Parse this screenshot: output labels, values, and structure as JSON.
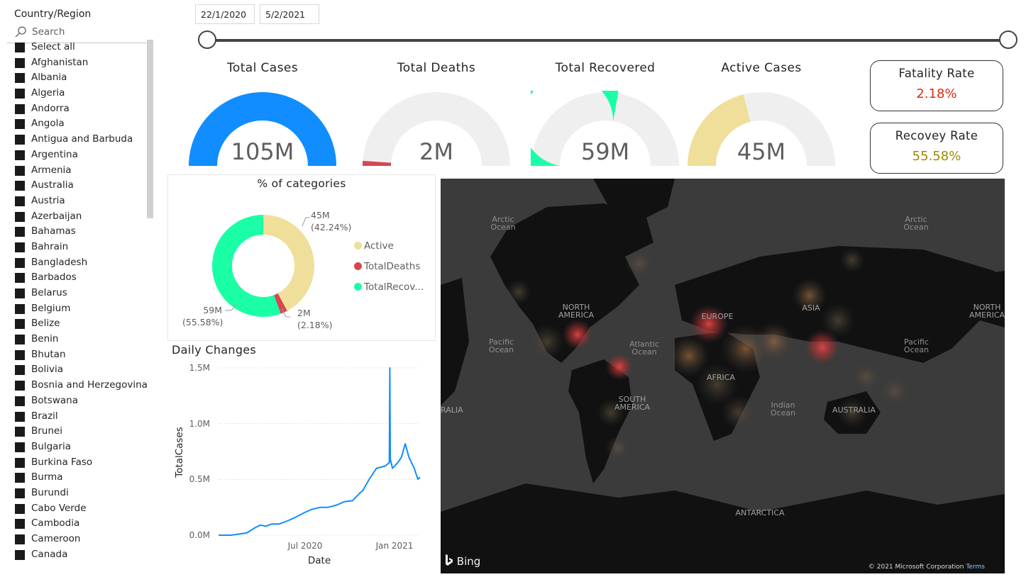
{
  "slicer": {
    "title": "Country/Region",
    "search_placeholder": "Search",
    "items": [
      "Select all",
      "Afghanistan",
      "Albania",
      "Algeria",
      "Andorra",
      "Angola",
      "Antigua and Barbuda",
      "Argentina",
      "Armenia",
      "Australia",
      "Austria",
      "Azerbaijan",
      "Bahamas",
      "Bahrain",
      "Bangladesh",
      "Barbados",
      "Belarus",
      "Belgium",
      "Belize",
      "Benin",
      "Bhutan",
      "Bolivia",
      "Bosnia and Herzegovina",
      "Botswana",
      "Brazil",
      "Brunei",
      "Bulgaria",
      "Burkina Faso",
      "Burma",
      "Burundi",
      "Cabo Verde",
      "Cambodia",
      "Cameroon",
      "Canada"
    ]
  },
  "date_range": {
    "start": "22/1/2020",
    "end": "5/2/2021"
  },
  "gauges": [
    {
      "title": "Total Cases",
      "value": "105M",
      "fraction": 1.0,
      "color": "#118DFF"
    },
    {
      "title": "Total Deaths",
      "value": "2M",
      "fraction": 0.0218,
      "color": "#D64550"
    },
    {
      "title": "Total Recovered",
      "value": "59M",
      "fraction": 0.5558,
      "color": "#1AFFA6"
    },
    {
      "title": "Active Cases",
      "value": "45M",
      "fraction": 0.4224,
      "color": "#F0DF9A"
    }
  ],
  "rates": {
    "fatality": {
      "title": "Fatality Rate",
      "value": "2.18%",
      "color": "#E02B10"
    },
    "recovery": {
      "title": "Recovey Rate",
      "value": "55.58%",
      "color": "#A08A00"
    }
  },
  "donut": {
    "title": "% of categories",
    "legend": [
      {
        "label": "Active",
        "color": "#F0DF9A"
      },
      {
        "label": "TotalDeaths",
        "color": "#D64550"
      },
      {
        "label": "TotalRecov...",
        "color": "#1AFFA6"
      }
    ],
    "labels": {
      "active": {
        "value": "45M",
        "pct": "(42.24%)"
      },
      "deaths": {
        "value": "2M",
        "pct": "(2.18%)"
      },
      "recovered": {
        "value": "59M",
        "pct": "(55.58%)"
      }
    }
  },
  "chart_data": [
    {
      "type": "pie",
      "title": "% of categories",
      "categories": [
        "Active",
        "TotalDeaths",
        "TotalRecovered"
      ],
      "values": [
        45,
        2,
        59
      ],
      "percent": [
        42.24,
        2.18,
        55.58
      ],
      "unit": "M",
      "legend": "right"
    },
    {
      "type": "line",
      "title": "Daily Changes",
      "xlabel": "Date",
      "ylabel": "TotalCases",
      "x_ticks": [
        "Jul 2020",
        "Jan 2021"
      ],
      "y_ticks": [
        "0.0M",
        "0.5M",
        "1.0M",
        "1.5M"
      ],
      "ylim": [
        0,
        1.5
      ],
      "x_range": [
        "2020-01-22",
        "2021-02-05"
      ],
      "series": [
        {
          "color": "#118DFF",
          "x": [
            "2020-01-22",
            "2020-02-15",
            "2020-03-15",
            "2020-04-01",
            "2020-04-10",
            "2020-04-20",
            "2020-05-01",
            "2020-05-15",
            "2020-06-01",
            "2020-06-15",
            "2020-07-01",
            "2020-07-15",
            "2020-08-01",
            "2020-08-15",
            "2020-09-01",
            "2020-09-15",
            "2020-10-01",
            "2020-10-15",
            "2020-10-20",
            "2020-11-01",
            "2020-11-15",
            "2020-12-01",
            "2020-12-09",
            "2020-12-10",
            "2020-12-11",
            "2020-12-15",
            "2020-12-25",
            "2021-01-01",
            "2021-01-08",
            "2021-01-15",
            "2021-01-25",
            "2021-02-01",
            "2021-02-05"
          ],
          "y": [
            0.0,
            0.0,
            0.02,
            0.07,
            0.09,
            0.08,
            0.1,
            0.1,
            0.13,
            0.16,
            0.2,
            0.23,
            0.25,
            0.25,
            0.27,
            0.3,
            0.31,
            0.38,
            0.4,
            0.5,
            0.6,
            0.62,
            0.65,
            1.5,
            0.68,
            0.6,
            0.65,
            0.7,
            0.82,
            0.7,
            0.6,
            0.5,
            0.52
          ]
        }
      ]
    }
  ],
  "line": {
    "title": "Daily Changes",
    "xlabel": "Date",
    "ylabel": "TotalCases",
    "x_tick_1": "Jul 2020",
    "x_tick_2": "Jan 2021",
    "y0": "0.0M",
    "y1": "0.5M",
    "y2": "1.0M",
    "y3": "1.5M"
  },
  "map": {
    "labels": {
      "north_america": "NORTH AMERICA",
      "north_america_2": "NORTH AMERICA",
      "europe": "EUROPE",
      "asia": "ASIA",
      "africa": "AFRICA",
      "south_america": "SOUTH AMERICA",
      "australia": "AUSTRALIA",
      "australia_2": "RALIA",
      "antarctica": "ANTARCTICA",
      "arctic_1": "Arctic Ocean",
      "arctic_2": "Arctic Ocean",
      "pacific_1": "Pacific Ocean",
      "pacific_2": "Pacific Ocean",
      "atlantic": "Atlantic Ocean",
      "indian": "Indian Ocean"
    },
    "brand": "Bing",
    "copyright": "© 2021 Microsoft Corporation",
    "terms": "Terms"
  }
}
